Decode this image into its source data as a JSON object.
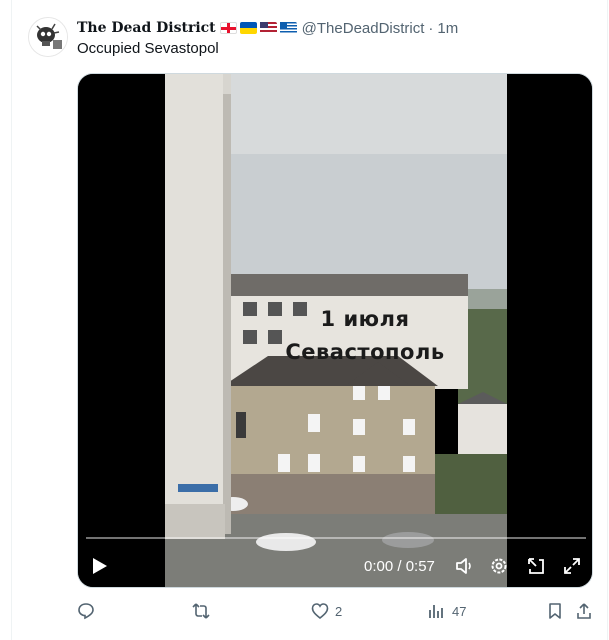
{
  "tweet": {
    "author_name": "The Dead District",
    "flags": [
      "georgia-flag-icon",
      "ukraine-flag-icon",
      "usa-flag-icon",
      "greece-flag-icon"
    ],
    "handle": "@TheDeadDistrict",
    "separator": "·",
    "timestamp": "1m",
    "text": "Occupied Sevastopol"
  },
  "video": {
    "overlay_line1": "1 июля",
    "overlay_line2": "Севастополь",
    "timecode": "0:00 / 0:57",
    "progress": 0,
    "accent": "#1d9bf0"
  },
  "actions": {
    "reply_count": "",
    "repost_count": "",
    "like_count": "2",
    "views_count": "47"
  },
  "colors": {
    "text_primary": "#0f1419",
    "text_secondary": "#536471"
  }
}
